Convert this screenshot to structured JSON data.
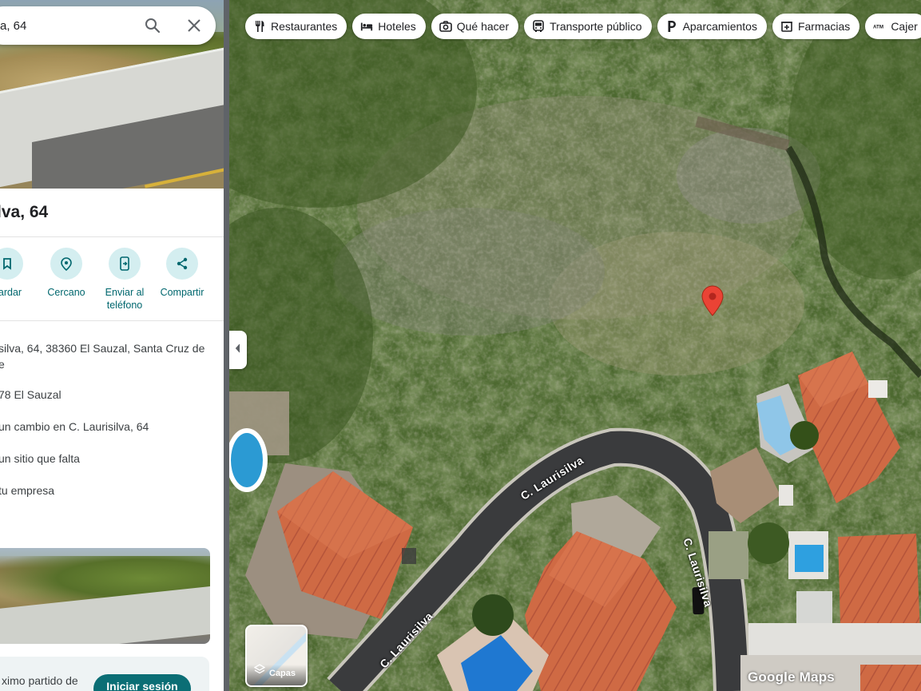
{
  "search": {
    "value": "a, 64"
  },
  "place": {
    "title": "lva, 64"
  },
  "actions": [
    {
      "label": "uardar",
      "icon": "bookmark-icon"
    },
    {
      "label": "Cercano",
      "icon": "nearby-icon"
    },
    {
      "label": "Enviar al teléfono",
      "icon": "send-to-phone-icon"
    },
    {
      "label": "Compartir",
      "icon": "share-icon"
    }
  ],
  "info": {
    "address_line1": "silva, 64, 38360 El Sauzal, Santa Cruz de",
    "address_line2": "e",
    "pluscode": "78 El Sauzal",
    "suggest_edit": "un cambio en C. Laurisilva, 64",
    "add_place": "un sitio que falta",
    "add_business": "tu empresa"
  },
  "signin": {
    "text": "ximo partido de",
    "button": "Iniciar sesión"
  },
  "chips": [
    {
      "label": "Restaurantes",
      "icon": "restaurant-icon"
    },
    {
      "label": "Hoteles",
      "icon": "hotel-icon"
    },
    {
      "label": "Qué hacer",
      "icon": "camera-icon"
    },
    {
      "label": "Transporte público",
      "icon": "bus-icon"
    },
    {
      "label": "Aparcamientos",
      "icon": "parking-icon"
    },
    {
      "label": "Farmacias",
      "icon": "pharmacy-icon"
    },
    {
      "label": "Cajer",
      "icon": "atm-icon"
    }
  ],
  "map": {
    "layers_label": "Capas",
    "brand": "Google Maps",
    "streets": [
      "C. Laurisilva",
      "C. Laurisilva",
      "C. Laurisilva"
    ],
    "pin_color": "#ea4335",
    "accent": "#0b6e75"
  }
}
